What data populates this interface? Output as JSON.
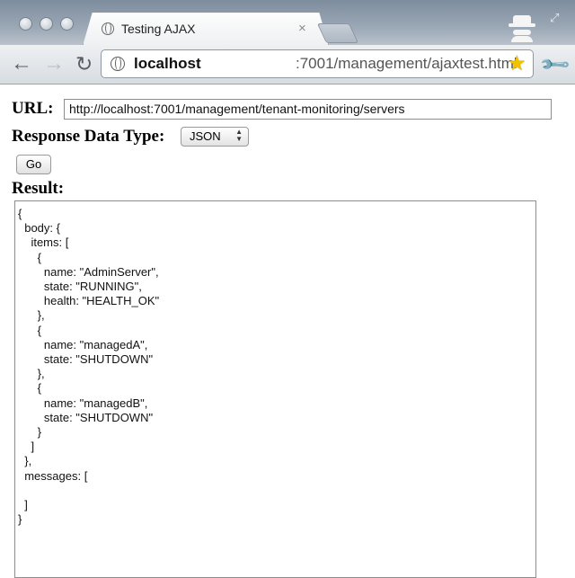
{
  "browser": {
    "tab_title": "Testing AJAX",
    "tab_close": "×",
    "address_host": "localhost",
    "address_path": ":7001/management/ajaxtest.html",
    "icons": {
      "back": "←",
      "forward": "→",
      "reload": "↻",
      "star": "★",
      "wrench": "🔧",
      "resize": "⤢"
    }
  },
  "form": {
    "url_label": "URL:",
    "url_value": "http://localhost:7001/management/tenant-monitoring/servers",
    "response_type_label": "Response Data Type:",
    "response_type_value": "JSON",
    "select_arrows": "▲▼",
    "go_label": "Go",
    "result_label": "Result:"
  },
  "result": {
    "text": "{\n  body: {\n    items: [\n      {\n        name: \"AdminServer\",\n        state: \"RUNNING\",\n        health: \"HEALTH_OK\"\n      },\n      {\n        name: \"managedA\",\n        state: \"SHUTDOWN\"\n      },\n      {\n        name: \"managedB\",\n        state: \"SHUTDOWN\"\n      }\n    ]\n  },\n  messages: [\n\n  ]\n}"
  }
}
